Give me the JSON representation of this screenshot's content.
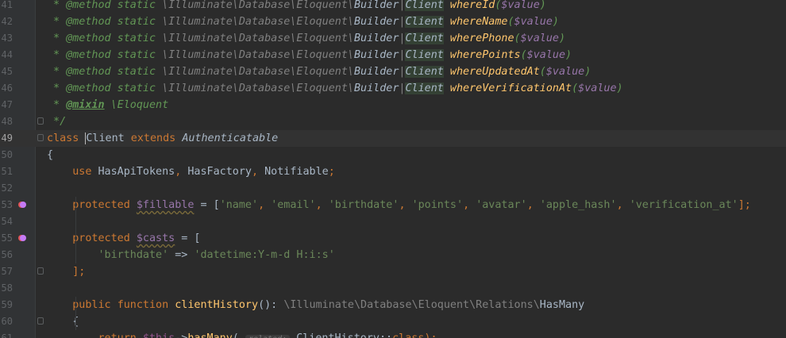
{
  "editor": {
    "current_line": 49,
    "lines": [
      {
        "n": "41",
        "segs": [
          {
            "t": " * ",
            "c": "cmt"
          },
          {
            "t": "@method",
            "c": "cm"
          },
          {
            "t": " static ",
            "c": "cm"
          },
          {
            "t": "\\Illuminate\\Database\\Eloquent\\",
            "c": "ns"
          },
          {
            "t": "Builder",
            "c": "cm2"
          },
          {
            "t": "|",
            "c": "ns"
          },
          {
            "t": "Client",
            "c": "cls-hl"
          },
          {
            "t": " ",
            "c": ""
          },
          {
            "t": "whereId",
            "c": "mname"
          },
          {
            "t": "(",
            "c": "cm"
          },
          {
            "t": "$value",
            "c": "var"
          },
          {
            "t": ")",
            "c": "cm"
          }
        ]
      },
      {
        "n": "42",
        "segs": [
          {
            "t": " * ",
            "c": "cmt"
          },
          {
            "t": "@method",
            "c": "cm"
          },
          {
            "t": " static ",
            "c": "cm"
          },
          {
            "t": "\\Illuminate\\Database\\Eloquent\\",
            "c": "ns"
          },
          {
            "t": "Builder",
            "c": "cm2"
          },
          {
            "t": "|",
            "c": "ns"
          },
          {
            "t": "Client",
            "c": "cls-hl"
          },
          {
            "t": " ",
            "c": ""
          },
          {
            "t": "whereName",
            "c": "mname"
          },
          {
            "t": "(",
            "c": "cm"
          },
          {
            "t": "$value",
            "c": "var"
          },
          {
            "t": ")",
            "c": "cm"
          }
        ]
      },
      {
        "n": "43",
        "segs": [
          {
            "t": " * ",
            "c": "cmt"
          },
          {
            "t": "@method",
            "c": "cm"
          },
          {
            "t": " static ",
            "c": "cm"
          },
          {
            "t": "\\Illuminate\\Database\\Eloquent\\",
            "c": "ns"
          },
          {
            "t": "Builder",
            "c": "cm2"
          },
          {
            "t": "|",
            "c": "ns"
          },
          {
            "t": "Client",
            "c": "cls-hl"
          },
          {
            "t": " ",
            "c": ""
          },
          {
            "t": "wherePhone",
            "c": "mname"
          },
          {
            "t": "(",
            "c": "cm"
          },
          {
            "t": "$value",
            "c": "var"
          },
          {
            "t": ")",
            "c": "cm"
          }
        ]
      },
      {
        "n": "44",
        "segs": [
          {
            "t": " * ",
            "c": "cmt"
          },
          {
            "t": "@method",
            "c": "cm"
          },
          {
            "t": " static ",
            "c": "cm"
          },
          {
            "t": "\\Illuminate\\Database\\Eloquent\\",
            "c": "ns"
          },
          {
            "t": "Builder",
            "c": "cm2"
          },
          {
            "t": "|",
            "c": "ns"
          },
          {
            "t": "Client",
            "c": "cls-hl"
          },
          {
            "t": " ",
            "c": ""
          },
          {
            "t": "wherePoints",
            "c": "mname"
          },
          {
            "t": "(",
            "c": "cm"
          },
          {
            "t": "$value",
            "c": "var"
          },
          {
            "t": ")",
            "c": "cm"
          }
        ]
      },
      {
        "n": "45",
        "segs": [
          {
            "t": " * ",
            "c": "cmt"
          },
          {
            "t": "@method",
            "c": "cm"
          },
          {
            "t": " static ",
            "c": "cm"
          },
          {
            "t": "\\Illuminate\\Database\\Eloquent\\",
            "c": "ns"
          },
          {
            "t": "Builder",
            "c": "cm2"
          },
          {
            "t": "|",
            "c": "ns"
          },
          {
            "t": "Client",
            "c": "cls-hl"
          },
          {
            "t": " ",
            "c": ""
          },
          {
            "t": "whereUpdatedAt",
            "c": "mname"
          },
          {
            "t": "(",
            "c": "cm"
          },
          {
            "t": "$value",
            "c": "var"
          },
          {
            "t": ")",
            "c": "cm"
          }
        ]
      },
      {
        "n": "46",
        "segs": [
          {
            "t": " * ",
            "c": "cmt"
          },
          {
            "t": "@method",
            "c": "cm"
          },
          {
            "t": " static ",
            "c": "cm"
          },
          {
            "t": "\\Illuminate\\Database\\Eloquent\\",
            "c": "ns"
          },
          {
            "t": "Builder",
            "c": "cm2"
          },
          {
            "t": "|",
            "c": "ns"
          },
          {
            "t": "Client",
            "c": "cls-hl"
          },
          {
            "t": " ",
            "c": ""
          },
          {
            "t": "whereVerificationAt",
            "c": "mname"
          },
          {
            "t": "(",
            "c": "cm"
          },
          {
            "t": "$value",
            "c": "var"
          },
          {
            "t": ")",
            "c": "cm"
          }
        ]
      },
      {
        "n": "47",
        "segs": [
          {
            "t": " * ",
            "c": "cmt"
          },
          {
            "t": "@mixin",
            "c": "mixin"
          },
          {
            "t": " \\Eloquent",
            "c": "cm"
          }
        ]
      },
      {
        "n": "48",
        "fold": true,
        "segs": [
          {
            "t": " */",
            "c": "cmt"
          }
        ]
      },
      {
        "n": "49",
        "fold": true,
        "current": true,
        "segs": [
          {
            "t": "class ",
            "c": "kw"
          },
          {
            "t": "|",
            "c": "caret"
          },
          {
            "t": "Client",
            "c": ""
          },
          {
            "t": " extends ",
            "c": "kw"
          },
          {
            "t": "Authenticatable",
            "c": "italic"
          }
        ]
      },
      {
        "n": "50",
        "segs": [
          {
            "t": "{",
            "c": ""
          }
        ]
      },
      {
        "n": "51",
        "segs": [
          {
            "t": "    ",
            "c": ""
          },
          {
            "t": "use ",
            "c": "kw"
          },
          {
            "t": "HasApiTokens",
            "c": ""
          },
          {
            "t": ", ",
            "c": "kw"
          },
          {
            "t": "HasFactory",
            "c": ""
          },
          {
            "t": ", ",
            "c": "kw"
          },
          {
            "t": "Notifiable",
            "c": ""
          },
          {
            "t": ";",
            "c": "kw"
          }
        ]
      },
      {
        "n": "52",
        "segs": []
      },
      {
        "n": "53",
        "marker": true,
        "segs": [
          {
            "t": "    ",
            "c": ""
          },
          {
            "t": "protected ",
            "c": "kw"
          },
          {
            "t": "$fillable",
            "c": "prop"
          },
          {
            "t": " = [",
            "c": ""
          },
          {
            "t": "'name'",
            "c": "str"
          },
          {
            "t": ", ",
            "c": "kw"
          },
          {
            "t": "'email'",
            "c": "str"
          },
          {
            "t": ", ",
            "c": "kw"
          },
          {
            "t": "'birthdate'",
            "c": "str"
          },
          {
            "t": ", ",
            "c": "kw"
          },
          {
            "t": "'points'",
            "c": "str"
          },
          {
            "t": ", ",
            "c": "kw"
          },
          {
            "t": "'avatar'",
            "c": "str"
          },
          {
            "t": ", ",
            "c": "kw"
          },
          {
            "t": "'apple_hash'",
            "c": "str"
          },
          {
            "t": ", ",
            "c": "kw"
          },
          {
            "t": "'verification_at'",
            "c": "str"
          },
          {
            "t": "];",
            "c": "kw"
          }
        ]
      },
      {
        "n": "54",
        "segs": []
      },
      {
        "n": "55",
        "marker": true,
        "segs": [
          {
            "t": "    ",
            "c": ""
          },
          {
            "t": "protected ",
            "c": "kw"
          },
          {
            "t": "$casts",
            "c": "prop"
          },
          {
            "t": " = [",
            "c": ""
          }
        ]
      },
      {
        "n": "56",
        "segs": [
          {
            "t": "        ",
            "c": ""
          },
          {
            "t": "'birthdate'",
            "c": "str"
          },
          {
            "t": " => ",
            "c": ""
          },
          {
            "t": "'datetime:Y-m-d H:i:s'",
            "c": "str"
          }
        ]
      },
      {
        "n": "57",
        "fold": true,
        "segs": [
          {
            "t": "    ",
            "c": ""
          },
          {
            "t": "];",
            "c": "kw"
          }
        ]
      },
      {
        "n": "58",
        "segs": []
      },
      {
        "n": "59",
        "segs": [
          {
            "t": "    ",
            "c": ""
          },
          {
            "t": "public ",
            "c": "kw"
          },
          {
            "t": "function ",
            "c": "kw"
          },
          {
            "t": "clientHistory",
            "c": "fn"
          },
          {
            "t": "(): ",
            "c": ""
          },
          {
            "t": "\\Illuminate\\Database\\Eloquent\\Relations\\",
            "c": "gray"
          },
          {
            "t": "HasMany",
            "c": ""
          }
        ]
      },
      {
        "n": "60",
        "fold": true,
        "segs": [
          {
            "t": "    {",
            "c": ""
          }
        ]
      },
      {
        "n": "61",
        "segs": [
          {
            "t": "        ",
            "c": ""
          },
          {
            "t": "return ",
            "c": "kw"
          },
          {
            "t": "$this",
            "c": "this"
          },
          {
            "t": "->",
            "c": ""
          },
          {
            "t": "hasMany",
            "c": "fn"
          },
          {
            "t": "( ",
            "c": ""
          },
          {
            "t": "related:",
            "c": "hint"
          },
          {
            "t": " ClientHistory::",
            "c": ""
          },
          {
            "t": "class",
            "c": "kw"
          },
          {
            "t": ");",
            "c": "kw"
          }
        ]
      }
    ]
  }
}
